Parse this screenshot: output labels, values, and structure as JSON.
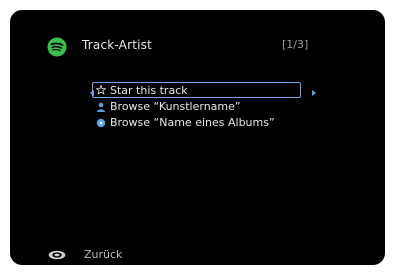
{
  "header": {
    "app_icon": "spotify-logo-icon",
    "title": "Track-Artist",
    "page_indicator": "[1/3]"
  },
  "menu": {
    "items": [
      {
        "icon": "star-icon",
        "label": "Star this track",
        "selected": true
      },
      {
        "icon": "person-icon",
        "label": "Browse  “Kunstlername”",
        "selected": false
      },
      {
        "icon": "disc-icon",
        "label": "Browse  “Name eines Albums”",
        "selected": false
      }
    ]
  },
  "footer": {
    "back_icon": "return-button-icon",
    "back_label": "Zurück"
  },
  "colors": {
    "background": "#000000",
    "accent": "#5aa0e0",
    "logo": "#3cbf4c"
  }
}
